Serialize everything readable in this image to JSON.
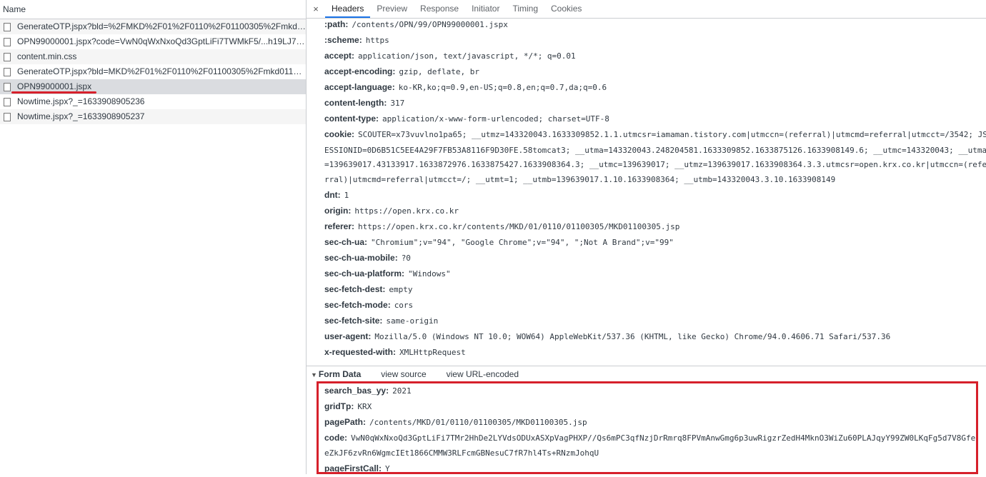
{
  "left_panel": {
    "name_header": "Name",
    "requests": [
      "GenerateOTP.jspx?bld=%2FMKD%2F01%2F0110%2F01100305%2Fmkd01...",
      "OPN99000001.jspx?code=VwN0qWxNxoQd3GptLiFi7TWMkF5/...h19LJ7+...",
      "content.min.css",
      "GenerateOTP.jspx?bld=MKD%2F01%2F0110%2F01100305%2Fmkd011003...",
      "OPN99000001.jspx",
      "Nowtime.jspx?_=1633908905236",
      "Nowtime.jspx?_=1633908905237"
    ],
    "selected_index": 4
  },
  "tabs": {
    "close": "×",
    "items": [
      "Headers",
      "Preview",
      "Response",
      "Initiator",
      "Timing",
      "Cookies"
    ],
    "active": "Headers"
  },
  "headers": {
    "path": {
      "k": ":path:",
      "v": "/contents/OPN/99/OPN99000001.jspx"
    },
    "scheme": {
      "k": ":scheme:",
      "v": "https"
    },
    "accept": {
      "k": "accept:",
      "v": "application/json, text/javascript, */*; q=0.01"
    },
    "accept_encoding": {
      "k": "accept-encoding:",
      "v": "gzip, deflate, br"
    },
    "accept_language": {
      "k": "accept-language:",
      "v": "ko-KR,ko;q=0.9,en-US;q=0.8,en;q=0.7,da;q=0.6"
    },
    "content_length": {
      "k": "content-length:",
      "v": "317"
    },
    "content_type": {
      "k": "content-type:",
      "v": "application/x-www-form-urlencoded; charset=UTF-8"
    },
    "cookie": {
      "k": "cookie:",
      "v1": "SCOUTER=x73vuvlno1pa65; __utmz=143320043.1633309852.1.1.utmcsr=iamaman.tistory.com|utmccn=(referral)|utmcmd=referral|utmcct=/3542; JS",
      "v2": "ESSIONID=0D6B51C5EE4A29F7FB53A8116F9D30FE.58tomcat3; __utma=143320043.248204581.1633309852.1633875126.1633908149.6; __utmc=143320043; __utma",
      "v3": "=139639017.43133917.1633872976.1633875427.1633908364.3; __utmc=139639017; __utmz=139639017.1633908364.3.3.utmcsr=open.krx.co.kr|utmccn=(refe",
      "v4": "rral)|utmcmd=referral|utmcct=/; __utmt=1; __utmb=139639017.1.10.1633908364; __utmb=143320043.3.10.1633908149"
    },
    "dnt": {
      "k": "dnt:",
      "v": "1"
    },
    "origin": {
      "k": "origin:",
      "v": "https://open.krx.co.kr"
    },
    "referer": {
      "k": "referer:",
      "v": "https://open.krx.co.kr/contents/MKD/01/0110/01100305/MKD01100305.jsp"
    },
    "sec_ch_ua": {
      "k": "sec-ch-ua:",
      "v": "\"Chromium\";v=\"94\", \"Google Chrome\";v=\"94\", \";Not A Brand\";v=\"99\""
    },
    "sec_ch_ua_mobile": {
      "k": "sec-ch-ua-mobile:",
      "v": "?0"
    },
    "sec_ch_ua_platform": {
      "k": "sec-ch-ua-platform:",
      "v": "\"Windows\""
    },
    "sec_fetch_dest": {
      "k": "sec-fetch-dest:",
      "v": "empty"
    },
    "sec_fetch_mode": {
      "k": "sec-fetch-mode:",
      "v": "cors"
    },
    "sec_fetch_site": {
      "k": "sec-fetch-site:",
      "v": "same-origin"
    },
    "user_agent": {
      "k": "user-agent:",
      "v": "Mozilla/5.0 (Windows NT 10.0; WOW64) AppleWebKit/537.36 (KHTML, like Gecko) Chrome/94.0.4606.71 Safari/537.36"
    },
    "x_requested_with": {
      "k": "x-requested-with:",
      "v": "XMLHttpRequest"
    }
  },
  "form_data": {
    "toggle": "▼",
    "title": "Form Data",
    "view_source": "view source",
    "view_url_encoded": "view URL-encoded",
    "search_bas_yy": {
      "k": "search_bas_yy:",
      "v": "2021"
    },
    "gridTp": {
      "k": "gridTp:",
      "v": "KRX"
    },
    "pagePath": {
      "k": "pagePath:",
      "v": "/contents/MKD/01/0110/01100305/MKD01100305.jsp"
    },
    "code": {
      "k": "code:",
      "v1": "VwN0qWxNxoQd3GptLiFi7TMr2HhDe2LYVdsODUxASXpVagPHXP//Qs6mPC3qfNzjDrRmrq8FPVmAnwGmg6p3uwRigzrZedH4MknO3WiZu60PLAJqyY99ZW0LKqFg5d7V8Gfe",
      "v2": "eZkJF6zvRn6WgmcIEt1866CMMW3RLFcmGBNesuC7fR7hl4Ts+RNzmJohqU"
    },
    "pageFirstCall": {
      "k": "pageFirstCall:",
      "v": "Y"
    }
  },
  "colors": {
    "highlight": "#d6202b",
    "tab_active": "#1a73e8"
  }
}
